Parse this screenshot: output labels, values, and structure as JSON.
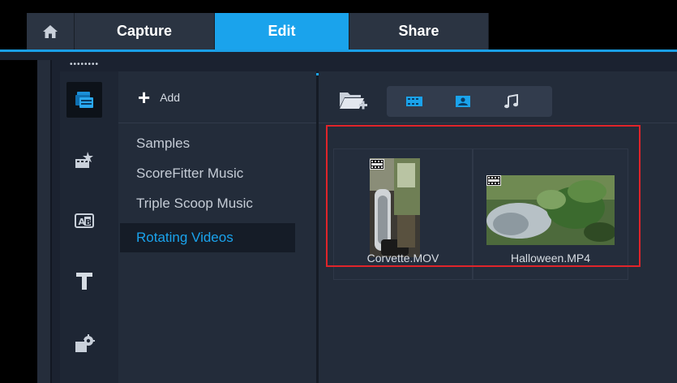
{
  "tabs": {
    "home": "home-icon",
    "capture": "Capture",
    "edit": "Edit",
    "share": "Share"
  },
  "colors": {
    "accent": "#1aa3ec",
    "highlight": "#e0242a",
    "background": "#1b2230"
  },
  "sidebar_icons": [
    "media-library-icon",
    "transitions-icon",
    "titles-icon",
    "text-icon",
    "filters-icon"
  ],
  "library": {
    "add_label": "Add",
    "items": [
      "Samples",
      "ScoreFitter Music",
      "Triple Scoop Music",
      "Rotating Videos"
    ],
    "selected": "Rotating Videos"
  },
  "toolbar": {
    "icons": [
      "import-folder-icon",
      "video-filter-icon",
      "photo-filter-icon",
      "audio-filter-icon"
    ]
  },
  "media": [
    {
      "name": "Corvette.MOV",
      "type": "video"
    },
    {
      "name": "Halloween.MP4",
      "type": "video"
    }
  ]
}
